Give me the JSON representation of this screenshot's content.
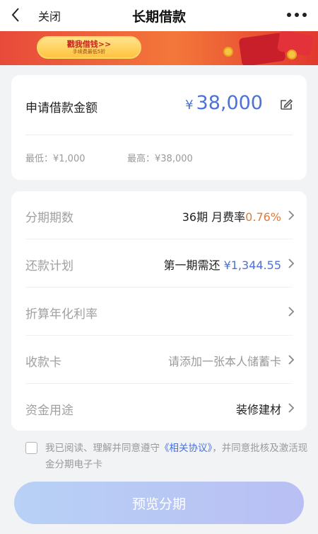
{
  "nav": {
    "close_label": "关闭",
    "title": "长期借款"
  },
  "banner": {
    "button_main": "戳我借钱>>",
    "button_sub": "手续费最低5折"
  },
  "amount": {
    "label": "申请借款金额",
    "currency": "¥",
    "value": "38,000",
    "min_text": "最低：¥1,000",
    "max_text": "最高：¥38,000"
  },
  "rows": [
    {
      "label": "分期期数",
      "value_plain": "36期  月费率",
      "value_accent": "0.76%"
    },
    {
      "label": "还款计划",
      "value_plain": "第一期需还 ",
      "value_accent": "¥1,344.55"
    },
    {
      "label": "折算年化利率",
      "value_plain": "",
      "value_accent": ""
    },
    {
      "label": "收款卡",
      "value_plain": "请添加一张本人储蓄卡",
      "value_accent": ""
    },
    {
      "label": "资金用途",
      "value_plain": "装修建材",
      "value_accent": ""
    }
  ],
  "agreement": {
    "prefix": "我已阅读、理解并同意遵守",
    "link": "《相关协议》",
    "suffix": "，并同意批核及激活现金分期电子卡"
  },
  "submit_label": "预览分期",
  "colors": {
    "accent_blue": "#4b72d9",
    "rate_orange": "#e07a3a"
  }
}
